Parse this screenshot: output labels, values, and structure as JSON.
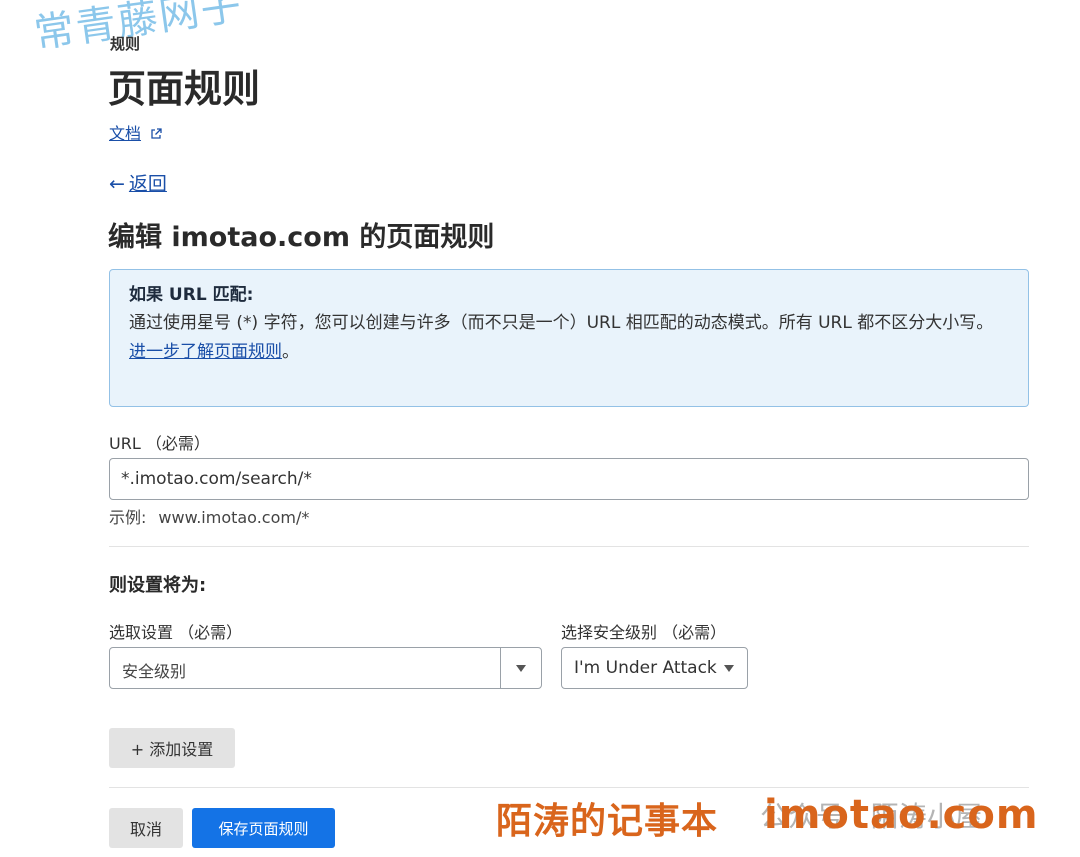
{
  "watermarks": {
    "top_left": "常青藤网子",
    "brand": "陌涛的记事本",
    "wechat": "公众号 · 陌涛小屋",
    "site": "imotao.com"
  },
  "header": {
    "breadcrumb": "规则",
    "title": "页面规则",
    "docs_link": "文档",
    "external_icon": "external-link-icon",
    "back_arrow": "←",
    "back_link": "返回"
  },
  "section": {
    "title": "编辑 imotao.com 的页面规则"
  },
  "info": {
    "heading": "如果 URL 匹配:",
    "body": "通过使用星号 (*) 字符，您可以创建与许多（而不只是一个）URL 相匹配的动态模式。所有 URL 都不区分大小写。",
    "link": "进一步了解页面规则",
    "link_suffix": "。"
  },
  "url_field": {
    "label": "URL （必需）",
    "value": "*.imotao.com/search/*",
    "example_label": "示例:",
    "example_value": "www.imotao.com/*"
  },
  "settings": {
    "heading": "则设置将为:",
    "setting_label": "选取设置 （必需）",
    "setting_value": "安全级别",
    "level_label": "选择安全级别 （必需）",
    "level_value": "I'm Under Attack",
    "add_button": "+ 添加设置"
  },
  "actions": {
    "cancel": "取消",
    "save": "保存页面规则"
  },
  "colors": {
    "link": "#1a4fa8",
    "info_bg": "#e9f3fb",
    "info_border": "#93c1e6",
    "primary": "#1473e6",
    "watermark_orange": "#d9651c"
  }
}
